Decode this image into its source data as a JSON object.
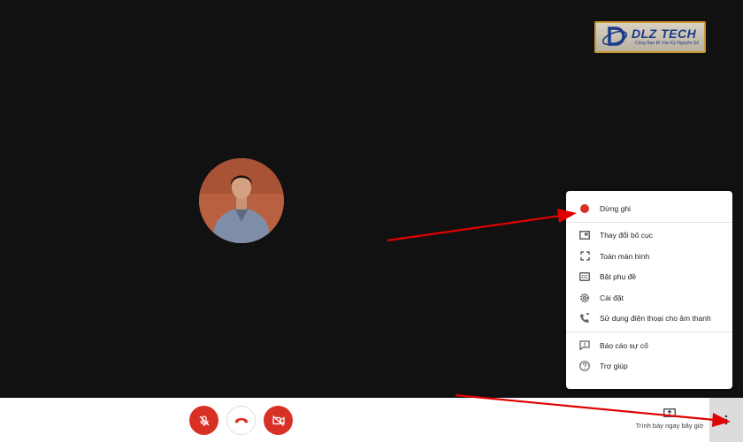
{
  "logo": {
    "name": "DLZ TECH",
    "tagline": "Cùng Bạn Đi Vào Kỷ Nguyên Số"
  },
  "menu": {
    "items": [
      {
        "label": "Dừng ghi",
        "icon": "record-dot-icon"
      },
      {
        "label": "Thay đổi bố cục",
        "icon": "layout-icon"
      },
      {
        "label": "Toàn màn hình",
        "icon": "fullscreen-icon"
      },
      {
        "label": "Bật phụ đề",
        "icon": "captions-icon"
      },
      {
        "label": "Cài đặt",
        "icon": "gear-icon"
      },
      {
        "label": "Sử dụng điện thoại cho âm thanh",
        "icon": "phone-audio-icon"
      },
      {
        "label": "Báo cáo sự cố",
        "icon": "report-icon"
      },
      {
        "label": "Trợ giúp",
        "icon": "help-icon"
      }
    ]
  },
  "controls": {
    "present_label": "Trình bày ngay bây giờ"
  },
  "colors": {
    "stage": "#111111",
    "danger": "#d93025",
    "arrow": "#e00000"
  }
}
